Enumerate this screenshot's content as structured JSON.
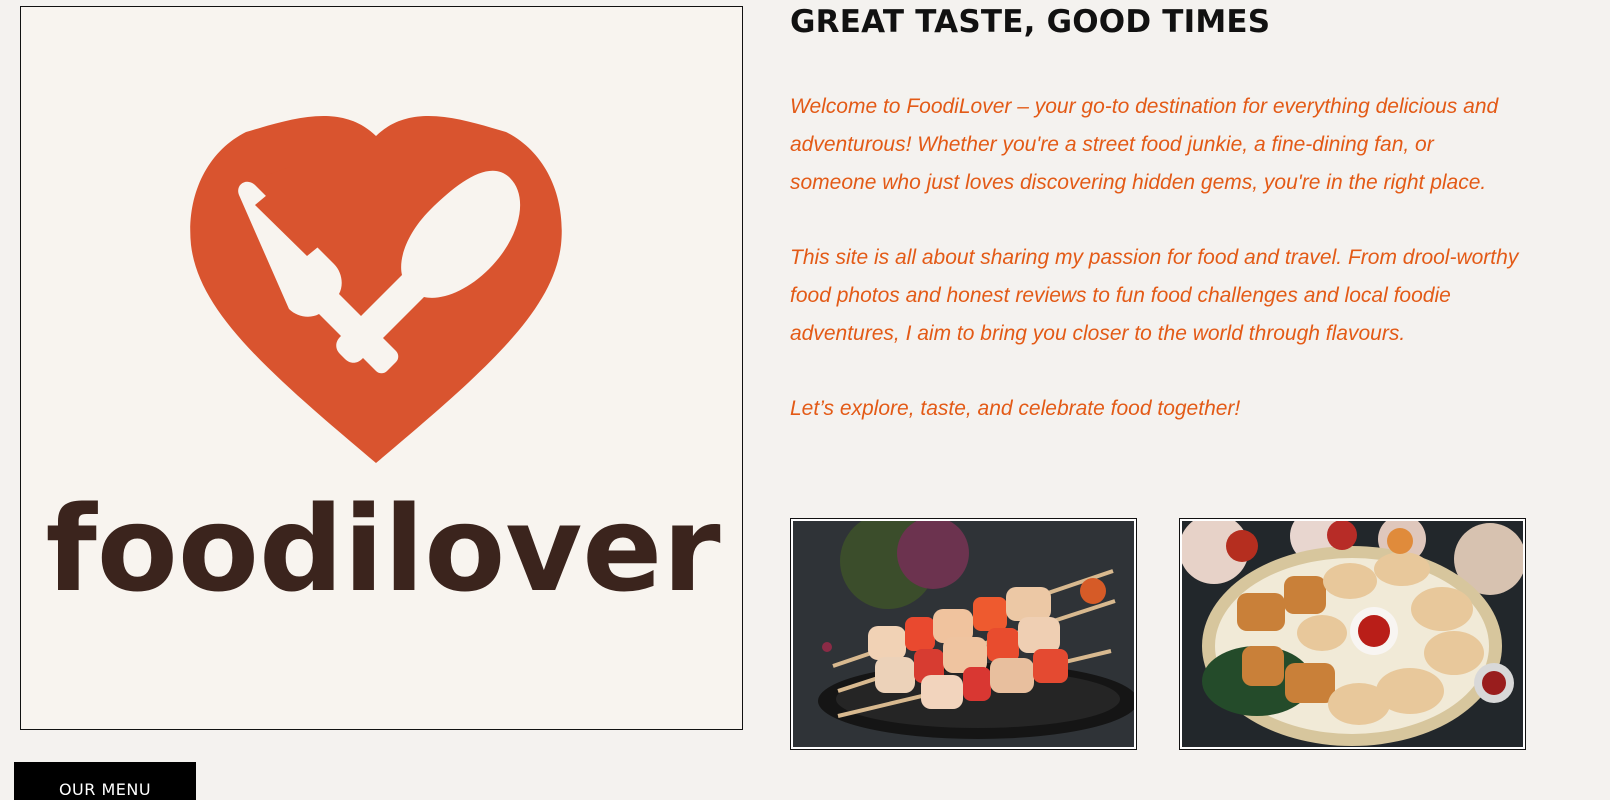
{
  "brand": {
    "logo_wordmark": "foodilover",
    "logo_icon": "heart-fork-spoon-icon",
    "accent_color": "#d9542f",
    "text_color": "#3b241d"
  },
  "hero": {
    "heading": "GREAT TASTE, GOOD TIMES",
    "paragraphs": [
      "Welcome to FoodiLover – your go-to destination for everything delicious and adventurous! Whether you're a street food junkie, a fine-dining fan, or someone who just loves discovering hidden gems, you're in the right place.",
      "This site is all about sharing my passion for food and travel. From drool-worthy food photos and honest reviews to fun food challenges and local foodie adventures, I aim to bring you closer to the world through flavours.",
      "Let’s explore, taste, and celebrate food together!"
    ]
  },
  "gallery": [
    {
      "icon": "grilled-skewers-photo"
    },
    {
      "icon": "dumpling-platter-photo"
    }
  ],
  "actions": {
    "menu_button": "OUR MENU"
  }
}
